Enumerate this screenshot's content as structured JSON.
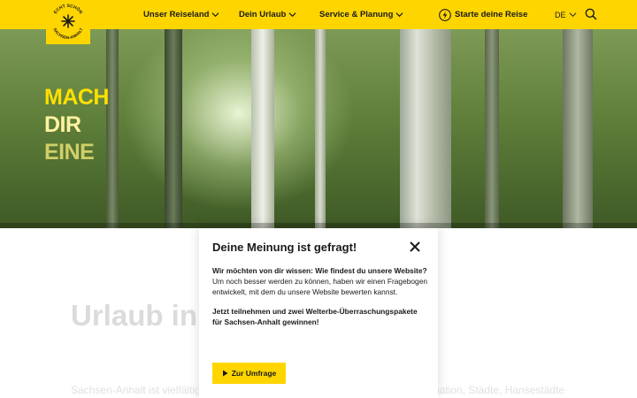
{
  "header": {
    "logo": {
      "text_top": "ECHT SCHÖN",
      "text_bottom": "SACHSEN-ANHALT"
    },
    "nav": [
      {
        "label": "Unser Reiseland"
      },
      {
        "label": "Dein Urlaub"
      },
      {
        "label": "Service & Planung"
      }
    ],
    "cta_label": "Starte deine Reise",
    "language": "DE",
    "brand_color": "#ffd500"
  },
  "hero": {
    "lines": [
      "MACH",
      "DIR",
      "EINE"
    ],
    "text_color": "#ffe000"
  },
  "content": {
    "title": "Urlaub in Sachsen-Anhalt",
    "text": "Sachsen-Anhalt ist vielfältig: Unesco-Welterbe, Dome, den Spuren der Reformation, Städte, Hansestädte"
  },
  "modal": {
    "title": "Deine Meinung ist gefragt!",
    "question": "Wir möchten von dir wissen: Wie findest du unsere Website?",
    "body": "Um noch besser werden zu können, haben wir einen Fragebogen entwickelt, mit dem du unsere Website bewerten kannst.",
    "cta_text": "Jetzt teilnehmen und zwei Welterbe-Überraschungspakete für Sachsen-Anhalt gewinnen!",
    "button_label": "Zur Umfrage"
  }
}
